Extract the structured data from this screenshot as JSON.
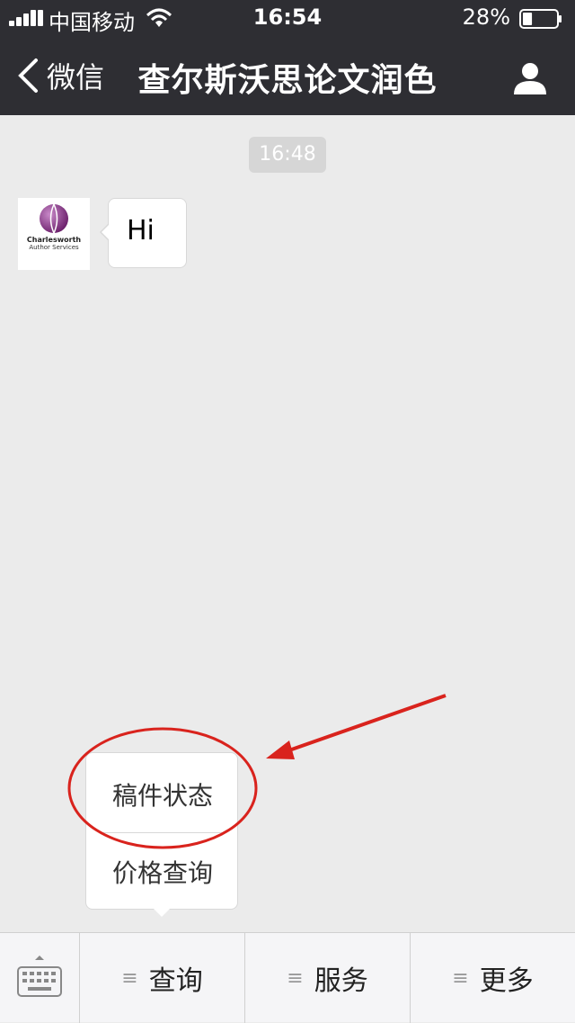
{
  "status_bar": {
    "carrier": "中国移动",
    "time": "16:54",
    "battery": "28%",
    "battery_level": 0.28
  },
  "nav": {
    "back_label": "微信",
    "title": "查尔斯沃思论文润色",
    "icons": {
      "back": "chevron-left-icon",
      "profile": "person-icon"
    }
  },
  "chat": {
    "timestamp": "16:48",
    "avatar": {
      "line1": "Charlesworth",
      "line2": "Author Services"
    },
    "message": "Hi"
  },
  "popup_menu": {
    "items": [
      "稿件状态",
      "价格查询"
    ]
  },
  "toolbar": {
    "keyboard_icon": "keyboard-icon",
    "menus": [
      {
        "label": "查询",
        "icon": "≡"
      },
      {
        "label": "服务",
        "icon": "≡"
      },
      {
        "label": "更多",
        "icon": "≡"
      }
    ]
  },
  "colors": {
    "bar_bg": "#2e2e33",
    "chat_bg": "#ebebeb",
    "annotation_red": "#d9231d",
    "brand_purple": "#7a2a7a"
  }
}
